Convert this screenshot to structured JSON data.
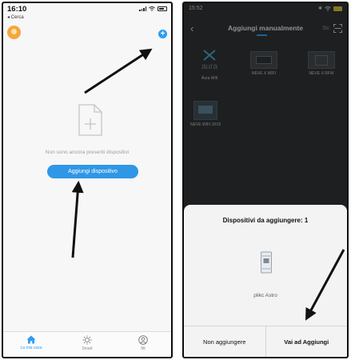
{
  "left_phone": {
    "status": {
      "time": "16:10",
      "back_label": "◂ Cerca"
    },
    "empty_state": {
      "text": "Non sono ancora presenti dispositivi"
    },
    "add_device_button": "Aggiungi dispositivo",
    "tabbar": [
      {
        "label": "La mia casa",
        "icon": "home-icon",
        "active": true
      },
      {
        "label": "Smart",
        "icon": "sun-icon",
        "active": false
      },
      {
        "label": "Mi",
        "icon": "profile-icon",
        "active": false
      }
    ]
  },
  "right_phone": {
    "status": {
      "time": "15:52"
    },
    "header": {
      "title": "Aggiungi manualmente",
      "partial_tab": "Sc"
    },
    "devices": [
      {
        "label": "Äura Wifi"
      },
      {
        "label": "NEVE X WIFI"
      },
      {
        "label": "NEVE X RFW"
      },
      {
        "label": "NEVE WIFI 2019"
      }
    ],
    "sheet": {
      "title": "Dispositivi da aggiungere: 1",
      "device_name": "plikc Astro",
      "cancel_label": "Non aggiungere",
      "confirm_label": "Vai ad Aggiungi"
    }
  },
  "colors": {
    "accent_blue": "#2e9df4",
    "button_blue": "#2f97e6",
    "avatar_orange": "#f4a73d",
    "dark_bg": "#2f3235",
    "arrow": "#111111"
  }
}
